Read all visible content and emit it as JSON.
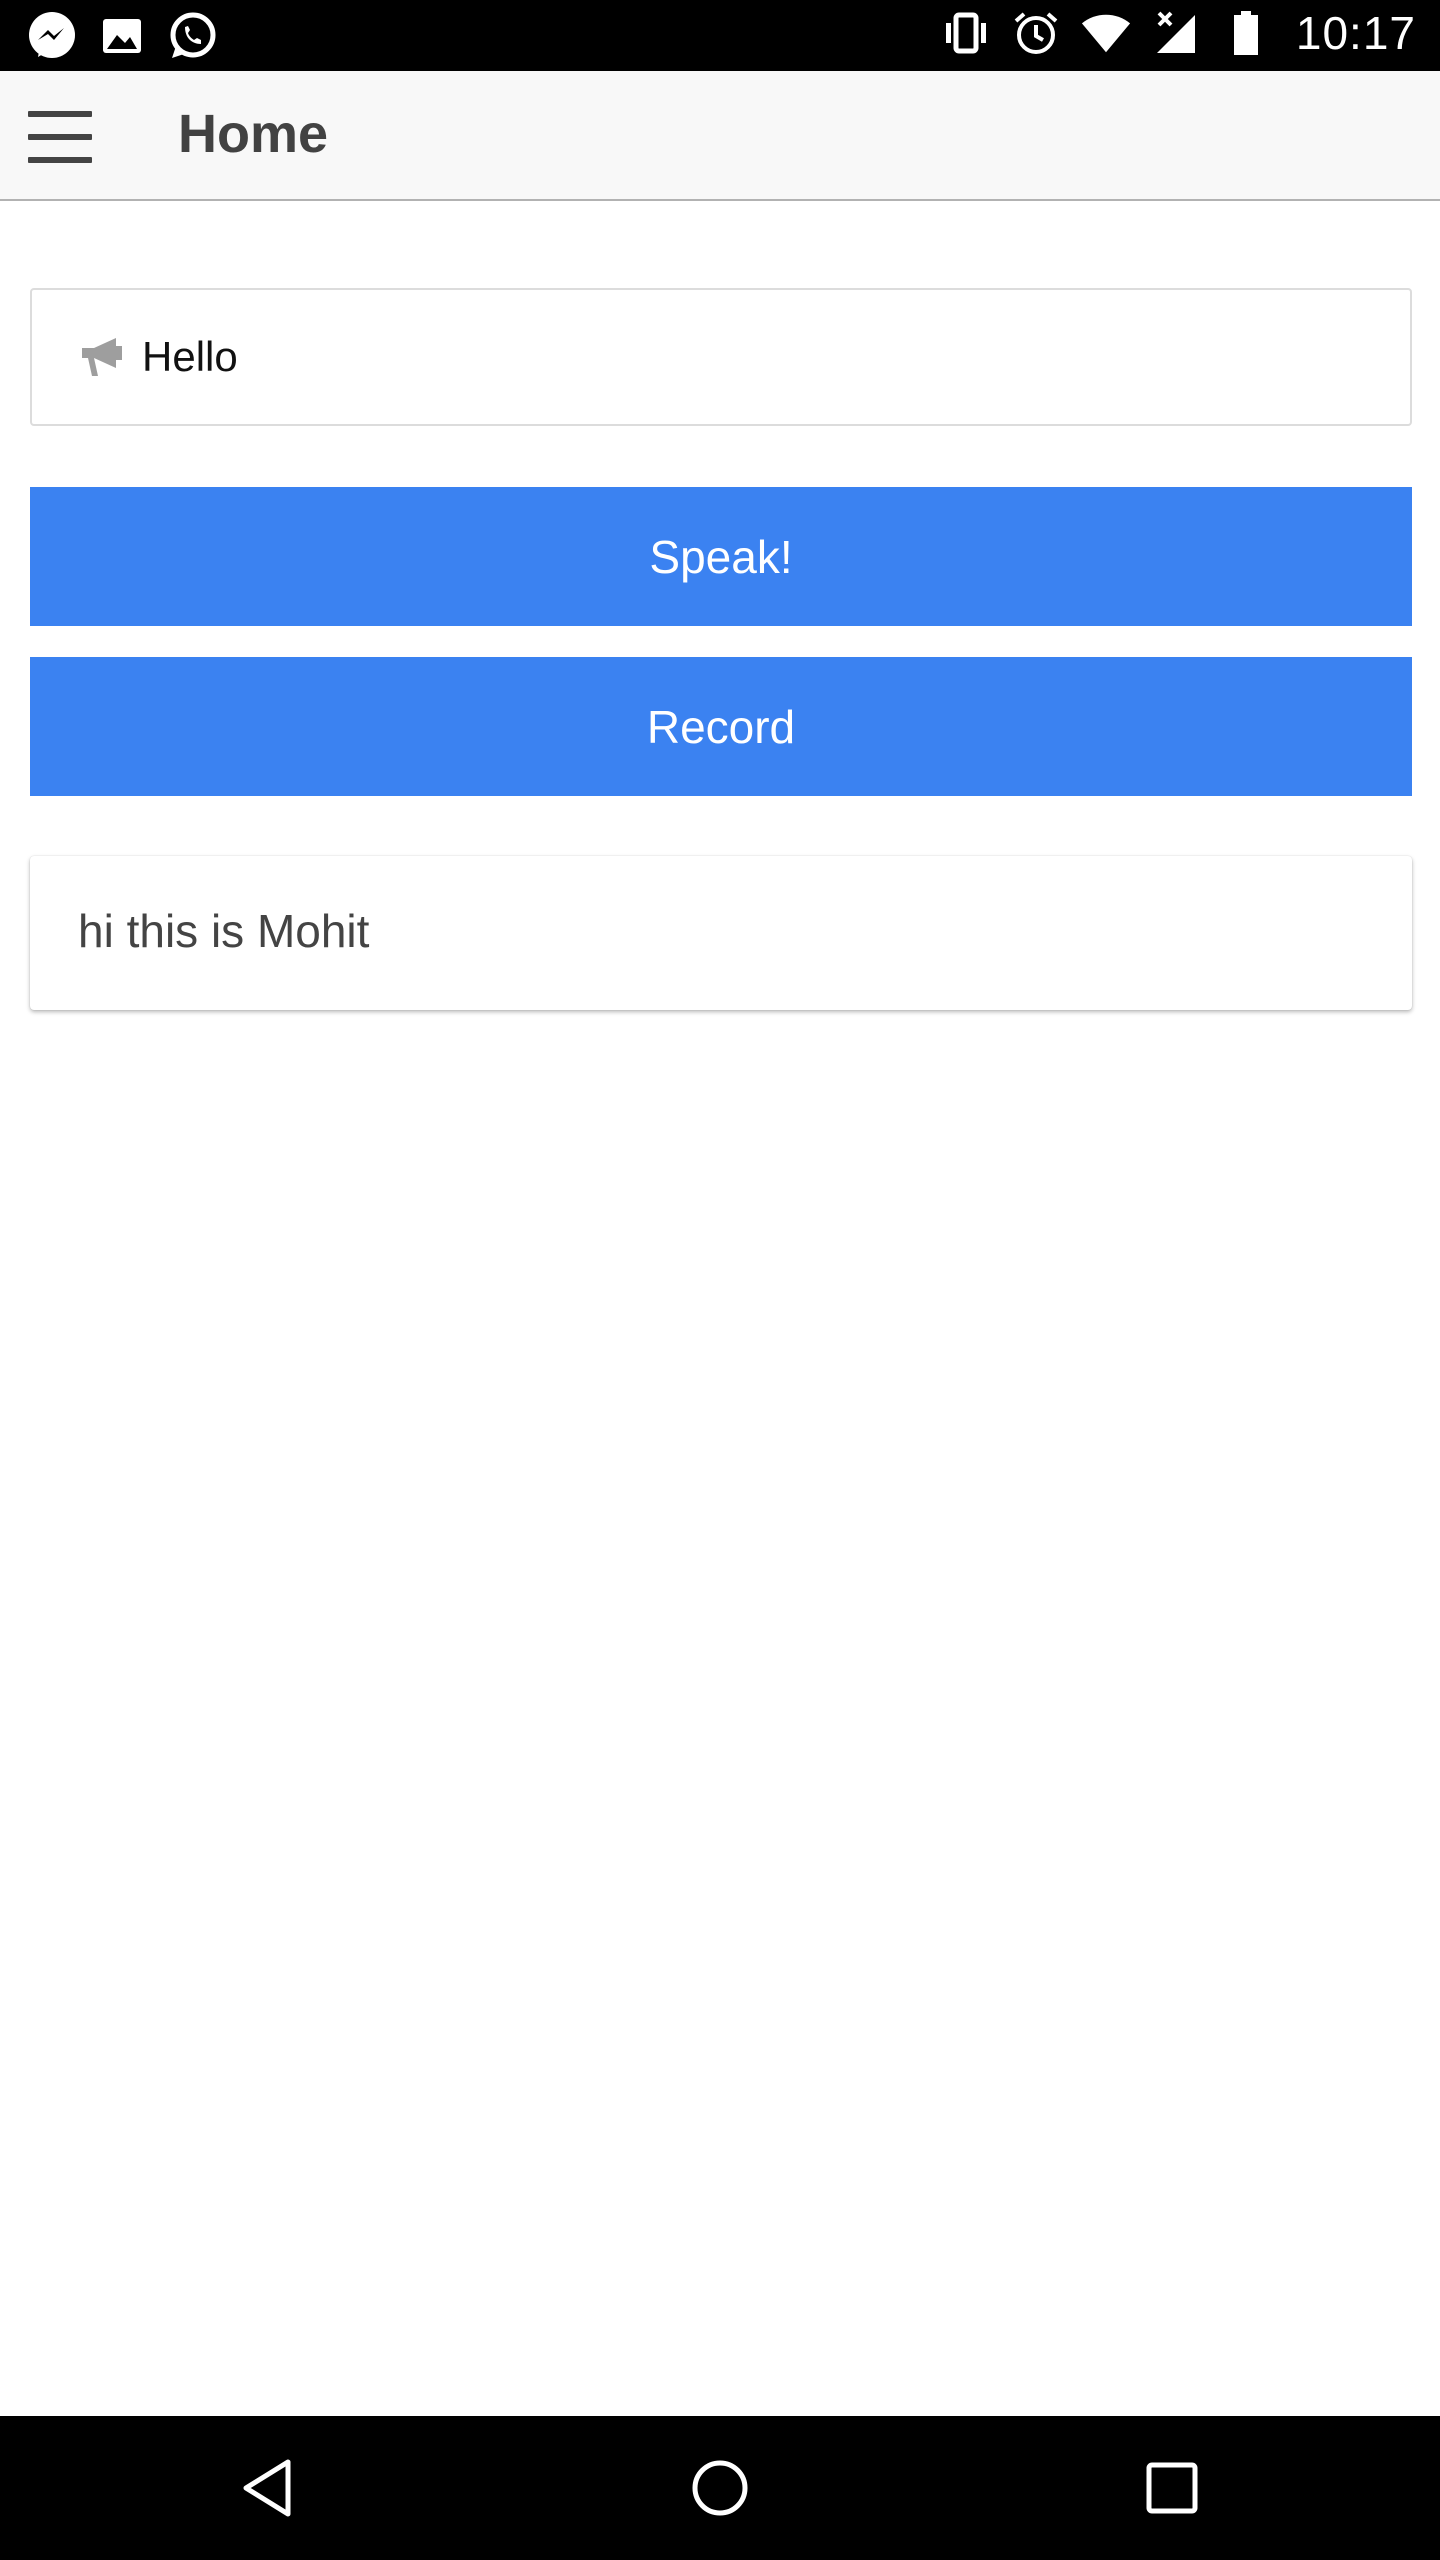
{
  "status_bar": {
    "time": "10:17",
    "left_icons": [
      "messenger-icon",
      "gallery-icon",
      "whatsapp-icon"
    ],
    "right_icons": [
      "vibrate-icon",
      "alarm-icon",
      "wifi-icon",
      "signal-icon",
      "battery-icon"
    ]
  },
  "app_bar": {
    "title": "Home",
    "menu_icon": "hamburger-menu-icon"
  },
  "speech_input": {
    "icon": "megaphone-icon",
    "value": "Hello"
  },
  "buttons": {
    "speak_label": "Speak!",
    "record_label": "Record"
  },
  "result": {
    "text": "hi this is Mohit"
  },
  "nav_bar": {
    "icons": [
      "back-icon",
      "home-icon",
      "recents-icon"
    ]
  },
  "colors": {
    "accent": "#3b82f1",
    "app_bar_bg": "#f8f8f8",
    "title_text": "#424242"
  }
}
